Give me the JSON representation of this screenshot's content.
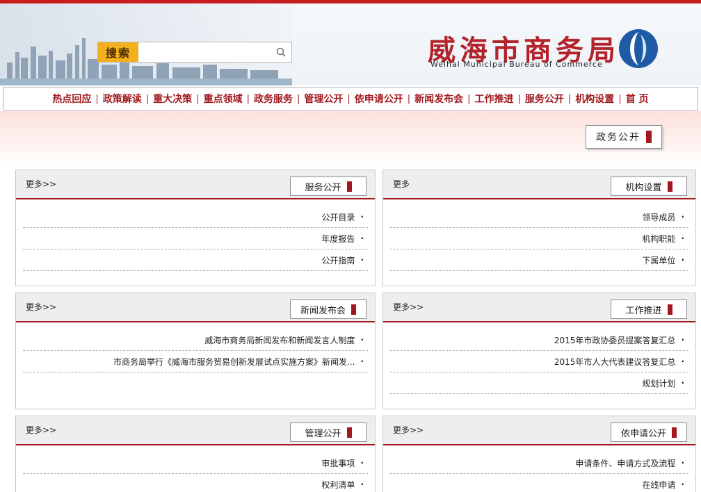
{
  "header": {
    "title": "威海市商务局",
    "subtitle": "Weihai Municipal Bureau of Commerce",
    "search_label": "搜索",
    "search_placeholder": ""
  },
  "nav": [
    "首 页",
    "机构设置",
    "服务公开",
    "工作推进",
    "新闻发布会",
    "依申请公开",
    "管理公开",
    "政务服务",
    "重点领域",
    "重大决策",
    "政策解读",
    "热点回应"
  ],
  "banner": {
    "label": "政务公开"
  },
  "panels": {
    "left1": {
      "more": "更多>>",
      "tab": "服务公开",
      "items": [
        "公开目录",
        "年度报告",
        "公开指南"
      ]
    },
    "right1": {
      "more": "更多",
      "tab": "机构设置",
      "items": [
        "领导成员",
        "机构职能",
        "下属单位"
      ]
    },
    "left2": {
      "more": "更多>>",
      "tab": "新闻发布会",
      "items": [
        "威海市商务局新闻发布和新闻发言人制度",
        "市商务局举行《威海市服务贸易创新发展试点实施方案》新闻发..."
      ]
    },
    "right2": {
      "more": "更多>>",
      "tab": "工作推进",
      "items": [
        "2015年市政协委员提案答复汇总",
        "2015年市人大代表建议答复汇总",
        "规划计划"
      ]
    },
    "left3": {
      "more": "更多>>",
      "tab": "管理公开",
      "items": [
        "审批事项",
        "权利清单"
      ]
    },
    "right3": {
      "more": "更多>>",
      "tab": "依申请公开",
      "items": [
        "申请条件、申请方式及流程",
        "在线申请"
      ]
    }
  },
  "colors": {
    "accent": "#a1191e",
    "top_bar": "#c71d1d",
    "search_button": "#f2b01e"
  }
}
